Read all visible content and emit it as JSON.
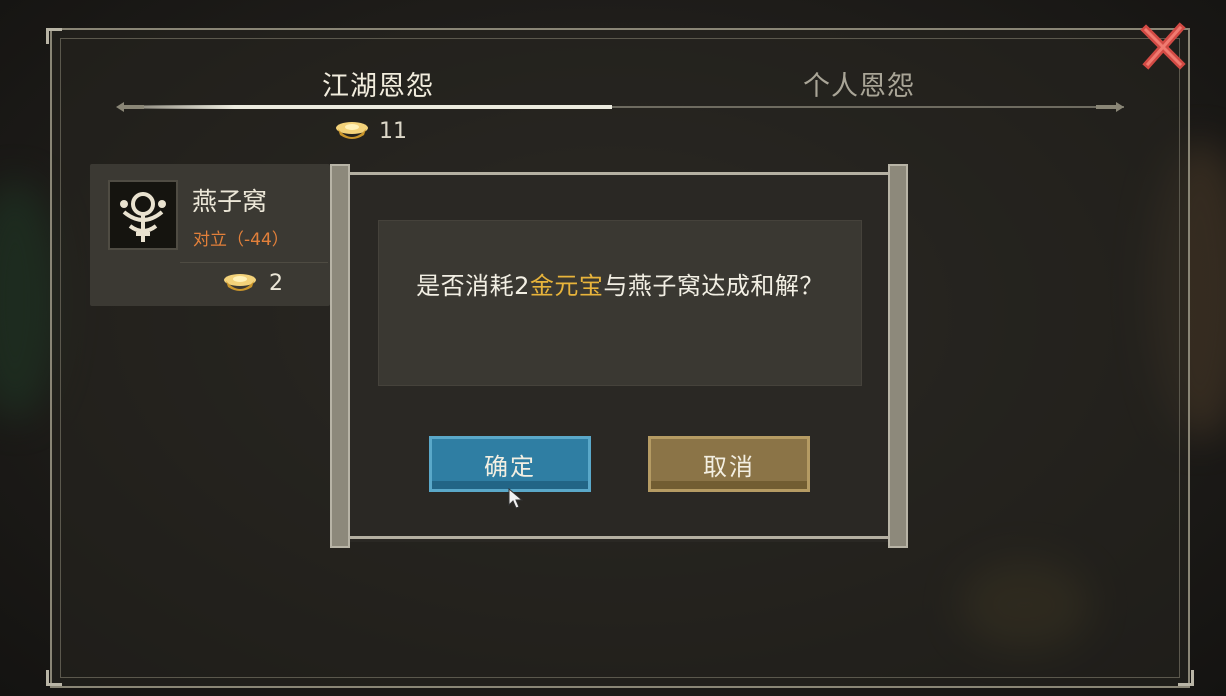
{
  "tabs": [
    {
      "label": "江湖恩怨",
      "active": true
    },
    {
      "label": "个人恩怨",
      "active": false
    }
  ],
  "currency": {
    "icon": "gold-ingot-icon",
    "amount": "11"
  },
  "target": {
    "name": "燕子窝",
    "status": "对立（-44）",
    "cost": "2",
    "icon": "emblem-icon"
  },
  "dialog": {
    "message_before": "是否消耗2",
    "message_highlight": "金元宝",
    "message_after": "与燕子窝达成和解？",
    "confirm_label": "确定",
    "cancel_label": "取消"
  },
  "colors": {
    "highlight": "#e8b43b",
    "status": "#e3803a",
    "confirm_button": "#2f7ea3",
    "cancel_button": "#8b7447",
    "close_icon": "#d9534f"
  }
}
